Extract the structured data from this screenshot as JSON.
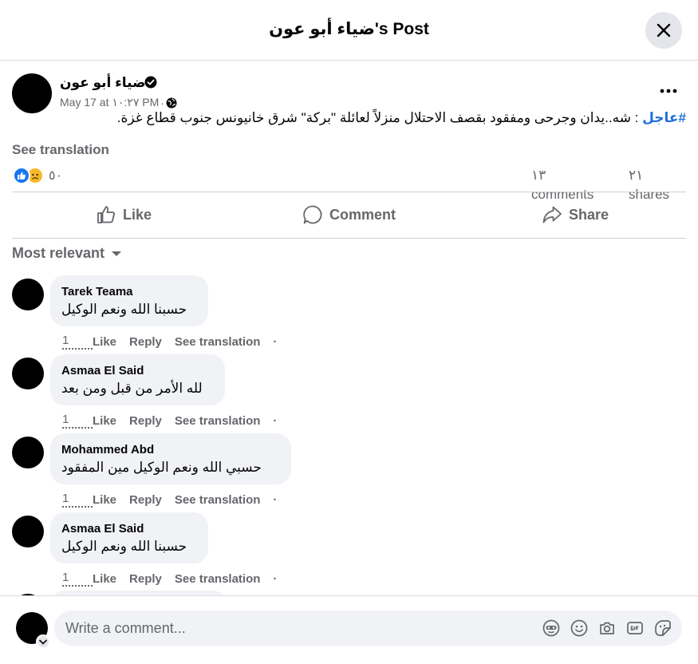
{
  "header": {
    "title": "ضياء أبو عون's Post"
  },
  "post": {
    "author": "ضياء أبو عون",
    "date": "May 17 at ١٠:٢٧ PM",
    "meta_separator": "·",
    "hashtag": "#عاجل",
    "text": " : شه..يدان وجرحى ومفقود بقصف الاحتلال منزلاً لعائلة \"بركة\" شرق خانيونس جنوب قطاع غزة.",
    "see_translation": "See translation",
    "reactions_count": "٥٠",
    "comments_count": "١٣ comments",
    "shares_count": "٢١ shares"
  },
  "actions": {
    "like": "Like",
    "comment": "Comment",
    "share": "Share"
  },
  "sort": {
    "label": "Most relevant"
  },
  "comments": [
    {
      "name": "Tarek Teama",
      "text": "حسبنا الله ونعم الوكيل",
      "time": "1",
      "like": "Like",
      "reply": "Reply",
      "translate": "See translation",
      "dot": "·"
    },
    {
      "name": "Asmaa El Said",
      "text": "لله الأمر من قبل ومن بعد",
      "time": "1",
      "like": "Like",
      "reply": "Reply",
      "translate": "See translation",
      "dot": "·"
    },
    {
      "name": "Mohammed Abd",
      "text": "حسبي الله ونعم الوكيل مين المفقود",
      "time": "1",
      "like": "Like",
      "reply": "Reply",
      "translate": "See translation",
      "dot": "·"
    },
    {
      "name": "Asmaa El Said",
      "text": "حسبنا الله ونعم الوكيل",
      "time": "1",
      "like": "Like",
      "reply": "Reply",
      "translate": "See translation",
      "dot": "·"
    }
  ],
  "composer": {
    "placeholder": "Write a comment..."
  },
  "icons": {
    "close": "close-icon",
    "verified": "verified-badge-icon",
    "globe": "globe-icon",
    "more": "more-horizontal-icon",
    "like_reaction": "like-reaction-icon",
    "sad_reaction": "sad-reaction-icon",
    "like": "thumbs-up-icon",
    "comment": "comment-bubble-icon",
    "share": "share-arrow-icon",
    "caret": "caret-down-icon",
    "avatar_sticker": "avatar-sticker-icon",
    "emoji": "emoji-icon",
    "camera": "camera-icon",
    "gif": "gif-icon",
    "sticker": "sticker-icon"
  },
  "colors": {
    "link_blue": "#216fdb",
    "like_blue": "#1877f2",
    "sad_yellow": "#f7b928",
    "secondary_text": "#65676b",
    "bubble_bg": "#f0f2f5"
  }
}
